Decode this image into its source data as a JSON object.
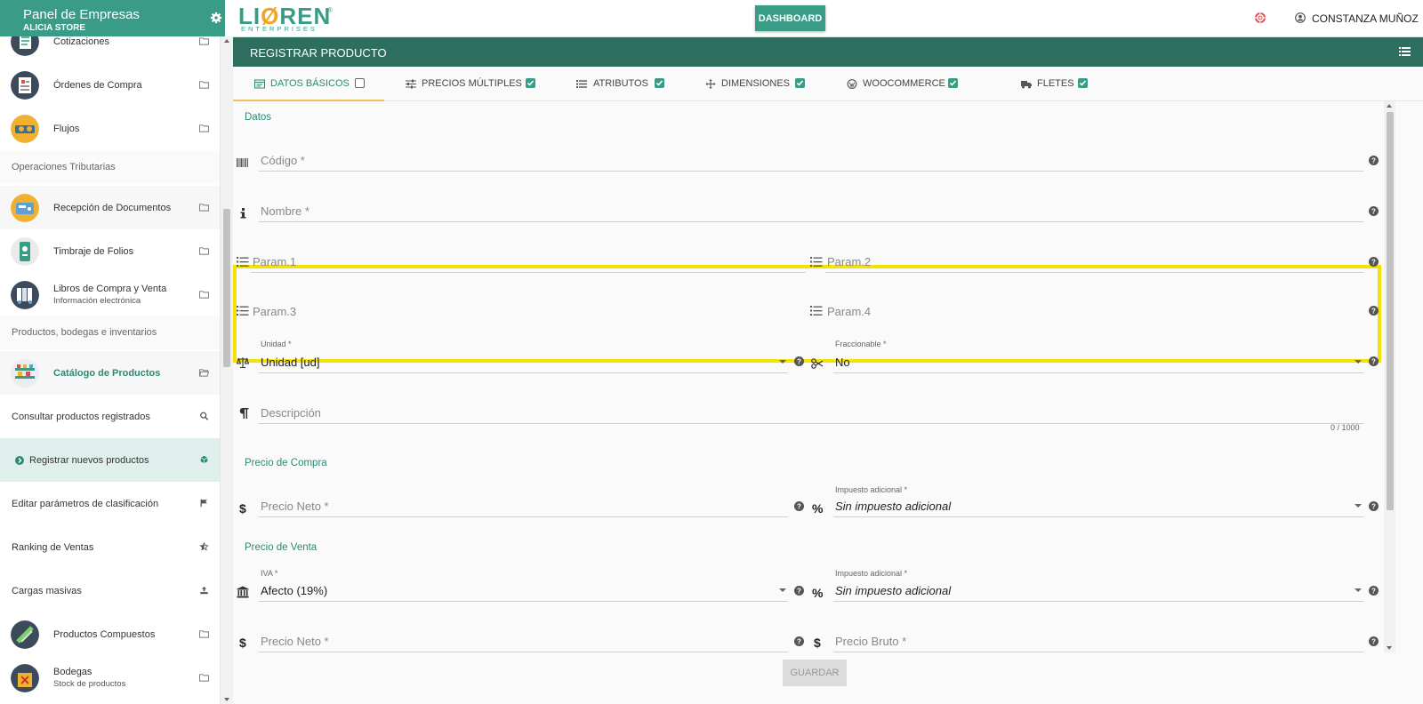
{
  "sidebar": {
    "title": "Panel de Empresas",
    "subtitle": "ALICIA STORE",
    "items": [
      {
        "label": "Cotizaciones"
      },
      {
        "label": "Órdenes de Compra"
      },
      {
        "label": "Flujos"
      },
      {
        "section": "Operaciones Tributarias"
      },
      {
        "label": "Recepción de Documentos"
      },
      {
        "label": "Timbraje de Folios"
      },
      {
        "label": "Libros de Compra y Venta",
        "sublabel": "Información electrónica"
      },
      {
        "section": "Productos, bodegas e inventarios"
      },
      {
        "label": "Catálogo de Productos"
      },
      {
        "label": "Consultar productos registrados"
      },
      {
        "label": "Registrar nuevos productos"
      },
      {
        "label": "Editar parámetros de clasificación"
      },
      {
        "label": "Ranking de Ventas"
      },
      {
        "label": "Cargas masivas"
      },
      {
        "label": "Productos Compuestos"
      },
      {
        "label": "Bodegas",
        "sublabel": "Stock de productos"
      }
    ]
  },
  "topbar": {
    "logo": "LIOREN",
    "logo_sub": "ENTERPRISES",
    "dashboard_label": "DASHBOARD",
    "user_name": "CONSTANZA MUÑOZ"
  },
  "page": {
    "title": "REGISTRAR PRODUCTO",
    "tabs": [
      {
        "label": "DATOS BÁSICOS",
        "checked": false,
        "icon": "card-icon"
      },
      {
        "label": "PRECIOS MÚLTIPLES",
        "checked": true,
        "icon": "sliders-icon"
      },
      {
        "label": "ATRIBUTOS",
        "checked": true,
        "icon": "list-icon"
      },
      {
        "label": "DIMENSIONES",
        "checked": true,
        "icon": "arrows-icon"
      },
      {
        "label": "WOOCOMMERCE",
        "checked": true,
        "icon": "wordpress-icon"
      },
      {
        "label": "FLETES",
        "checked": true,
        "icon": "truck-icon"
      }
    ]
  },
  "form": {
    "datos_title": "Datos",
    "codigo_ph": "Código *",
    "nombre_ph": "Nombre *",
    "param1_ph": "Param.1",
    "param2_ph": "Param.2",
    "param3_ph": "Param.3",
    "param4_ph": "Param.4",
    "unidad_label": "Unidad *",
    "unidad_value": "Unidad [ud]",
    "fraccionable_label": "Fraccionable *",
    "fraccionable_value": "No",
    "descripcion_ph": "Descripción",
    "descripcion_counter": "0 / 1000",
    "precio_compra_title": "Precio de Compra",
    "compra_neto_ph": "Precio Neto *",
    "compra_impuesto_label": "Impuesto adicional *",
    "compra_impuesto_value": "Sin impuesto adicional",
    "precio_venta_title": "Precio de Venta",
    "iva_label": "IVA *",
    "iva_value": "Afecto (19%)",
    "venta_impuesto_label": "Impuesto adicional *",
    "venta_impuesto_value": "Sin impuesto adicional",
    "venta_neto_ph": "Precio Neto *",
    "venta_bruto_ph": "Precio Bruto *",
    "save_label": "GUARDAR"
  },
  "colors": {
    "brand": "#3a9c86",
    "header": "#2d6e5e",
    "highlight": "#f4e300",
    "accent": "#f0a52a"
  }
}
